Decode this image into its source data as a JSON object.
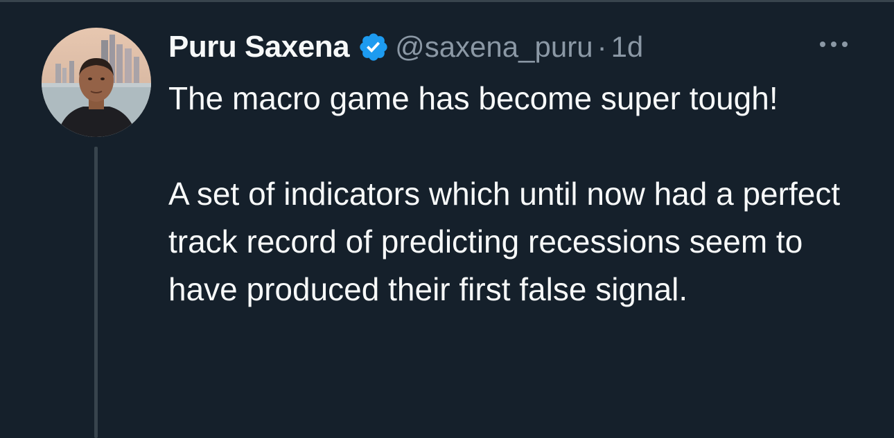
{
  "tweet": {
    "author_name": "Puru Saxena",
    "handle": "@saxena_puru",
    "separator": "·",
    "time": "1d",
    "verified_icon": "verified-badge-icon",
    "more_icon": "more-options-icon",
    "body_paragraphs": [
      "The macro game has become super tough!",
      "A set of indicators which until now had a perfect track record of predicting recessions seem to have produced their first false signal."
    ]
  },
  "colors": {
    "background": "#15202b",
    "text_primary": "#f7f9f9",
    "text_secondary": "#8b98a5",
    "verified": "#1d9bf0",
    "divider": "#38444d"
  }
}
